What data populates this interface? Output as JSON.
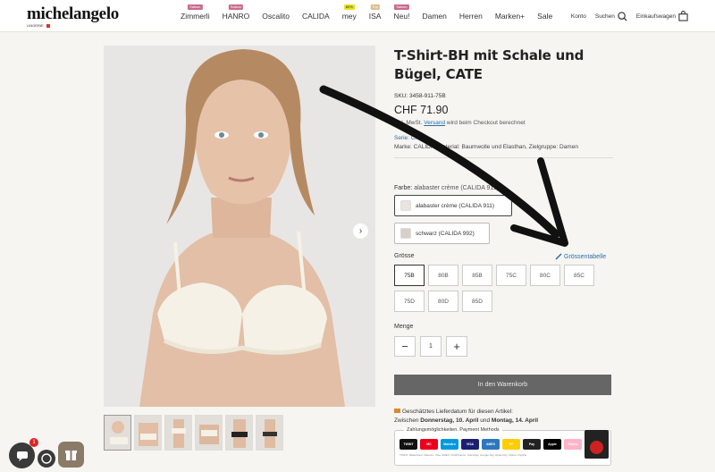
{
  "header": {
    "logo": "michelangelo",
    "logo_sub": "LINGERIE",
    "nav": [
      {
        "label": "Zimmerli",
        "badge": "Saison",
        "badge_color": "#c96b8a"
      },
      {
        "label": "HANRO",
        "badge": "Saison",
        "badge_color": "#c96b8a"
      },
      {
        "label": "Oscalito",
        "badge": "",
        "badge_color": ""
      },
      {
        "label": "CALIDA",
        "badge": "",
        "badge_color": ""
      },
      {
        "label": "mey",
        "badge": "80%",
        "badge_color": "#e8e020"
      },
      {
        "label": "ISA",
        "badge": "Top",
        "badge_color": "#d9c08a"
      },
      {
        "label": "Neu!",
        "badge": "Saison",
        "badge_color": "#c96b8a"
      },
      {
        "label": "Damen",
        "badge": "",
        "badge_color": ""
      },
      {
        "label": "Herren",
        "badge": "",
        "badge_color": ""
      },
      {
        "label": "Marken+",
        "badge": "",
        "badge_color": ""
      },
      {
        "label": "Sale",
        "badge": "",
        "badge_color": ""
      }
    ],
    "account": "Konto",
    "search": "Suchen",
    "cart": "Einkaufswagen"
  },
  "product": {
    "title": "T-Shirt-BH mit Schale und Bügel, CATE",
    "sku": "SKU: 3458-911-75B",
    "price": "CHF 71.90",
    "tax_prefix": "inkl. MwSt.",
    "tax_link": "Versand",
    "tax_suffix": "wird beim Checkout berechnet",
    "series": "Serie: CATE",
    "brand_line": "Marke: CALIDA, Material: Baumwolle und Elasthan, Zielgruppe: Damen",
    "color_label": "Farbe:",
    "color_value": "alabaster crème (CALIDA 911)",
    "colors": [
      "alabaster crème (CALIDA 911)",
      "schwarz (CALIDA 992)"
    ],
    "size_label": "Grösse",
    "size_chart": "Grössentabelle",
    "sizes": [
      "75B",
      "80B",
      "85B",
      "75C",
      "80C",
      "85C",
      "75D",
      "80D",
      "85D"
    ],
    "qty_label": "Menge",
    "qty": "1",
    "add_to_cart": "In den Warenkorb",
    "delivery_line1": "Geschätztes Lieferdatum für diesen Artikel:",
    "delivery_between": "Zwischen",
    "delivery_from": "Donnerstag, 10. April",
    "delivery_and": "und",
    "delivery_to": "Montag, 14. April",
    "payments_title": "Zahlungsmöglichkeiten. Payment Methods",
    "payment_icons": [
      "TWINT",
      "MC",
      "Maestro",
      "VISA",
      "AMEX",
      "PF",
      "Pay",
      "Apple",
      "Klarna",
      "PayPal"
    ],
    "payment_note": "TWINT, Mastercard, Maestro, Visa, AMEX, PostFinance, Sofortpay, Google Pay, Apple Pay, Klarna, PayPal"
  },
  "gallery": {
    "next": "›"
  },
  "widgets": {
    "notif_count": "1"
  }
}
